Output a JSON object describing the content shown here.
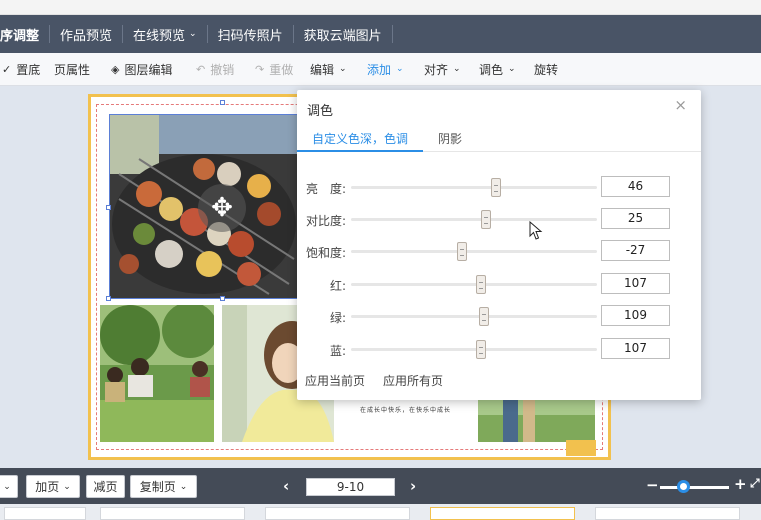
{
  "menu": {
    "items": [
      {
        "label": "序调整",
        "dropdown": false
      },
      {
        "label": "作品预览",
        "dropdown": false
      },
      {
        "label": "在线预览",
        "dropdown": true
      },
      {
        "label": "扫码传照片",
        "dropdown": false
      },
      {
        "label": "获取云端图片",
        "dropdown": false
      }
    ]
  },
  "toolbar": {
    "bottom_label": "置底",
    "page_props_label": "页属性",
    "layer_edit_label": "图层编辑",
    "undo_label": "撤销",
    "redo_label": "重做",
    "edit_label": "编辑",
    "add_label": "添加",
    "align_label": "对齐",
    "color_label": "调色",
    "rotate_label": "旋转"
  },
  "color_panel": {
    "title": "调色",
    "tabs": [
      {
        "label": "自定义色深，色调",
        "active": true
      },
      {
        "label": "阴影",
        "active": false
      }
    ],
    "sliders": [
      {
        "label": "亮　度:",
        "value": "46",
        "position": 0.59
      },
      {
        "label": "对比度:",
        "value": "25",
        "position": 0.55
      },
      {
        "label": "饱和度:",
        "value": "-27",
        "position": 0.45
      },
      {
        "label": "红:",
        "value": "107",
        "position": 0.53
      },
      {
        "label": "绿:",
        "value": "109",
        "position": 0.54
      },
      {
        "label": "蓝:",
        "value": "107",
        "position": 0.53
      }
    ],
    "apply_current": "应用当前页",
    "apply_all": "应用所有页"
  },
  "page": {
    "caption": "在成长中快乐，在快乐中成长"
  },
  "bottombar": {
    "add_page_label": "加页",
    "remove_page_label": "减页",
    "copy_page_label": "复制页",
    "page_range": "9-10",
    "zoom_level": 0.25
  },
  "colors": {
    "accent": "#2b8ee6",
    "menubar": "#495466",
    "page_border": "#f2c14e"
  }
}
